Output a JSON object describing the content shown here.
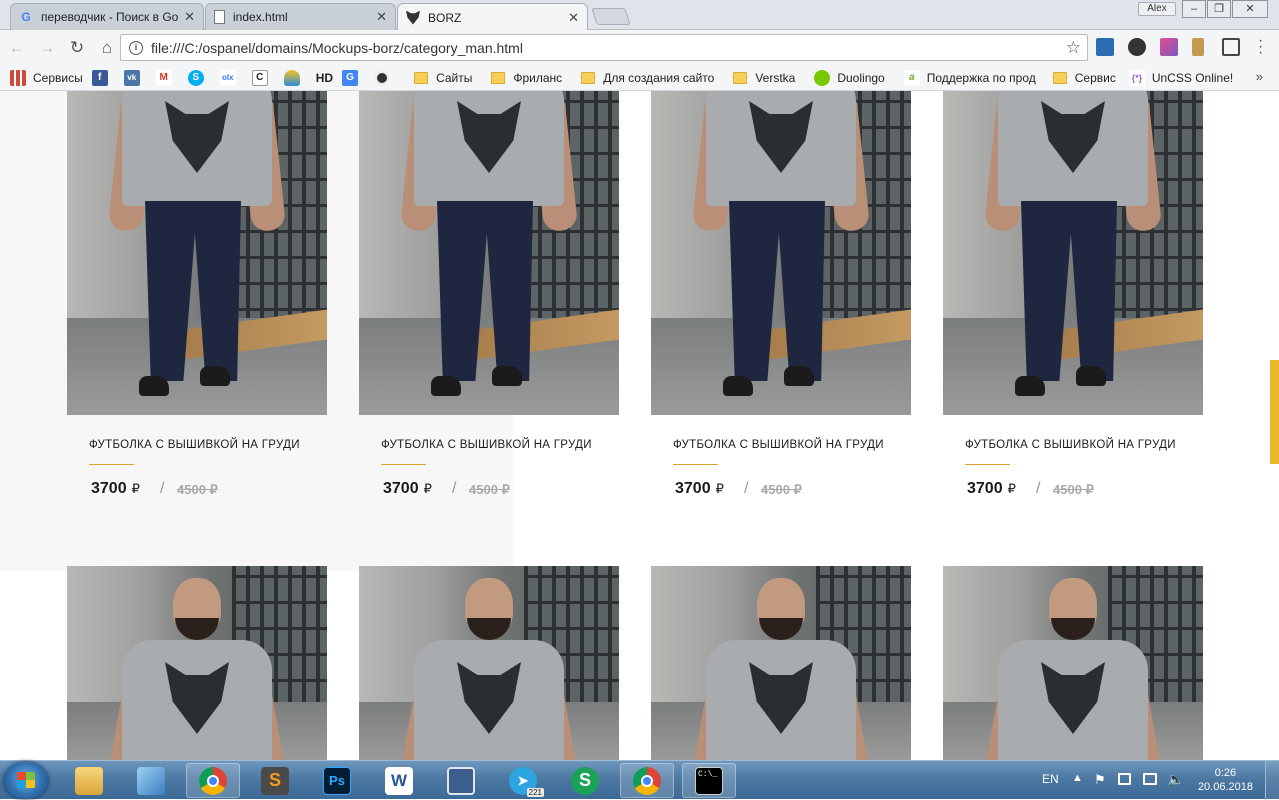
{
  "browser": {
    "tabs": [
      {
        "title": "переводчик - Поиск в Google",
        "icon": "google-icon"
      },
      {
        "title": "index.html",
        "icon": "page-icon"
      },
      {
        "title": "BORZ",
        "icon": "wolf-icon"
      }
    ],
    "user_label": "Alex",
    "url": "file:///C:/ospanel/domains/Mockups-borz/category_man.html",
    "bookmarks": [
      {
        "label": "Сервисы",
        "type": "apps"
      },
      {
        "label": "",
        "type": "facebook"
      },
      {
        "label": "",
        "type": "vk"
      },
      {
        "label": "",
        "type": "gmail"
      },
      {
        "label": "",
        "type": "skype"
      },
      {
        "label": "",
        "type": "olx"
      },
      {
        "label": "",
        "type": "cyrillic"
      },
      {
        "label": "",
        "type": "cloud"
      },
      {
        "label": "HD",
        "type": "text"
      },
      {
        "label": "",
        "type": "translate"
      },
      {
        "label": "",
        "type": "record"
      },
      {
        "label": "Сайты",
        "type": "folder"
      },
      {
        "label": "Фриланс",
        "type": "folder"
      },
      {
        "label": "Для создания сайто",
        "type": "folder"
      },
      {
        "label": "Verstka",
        "type": "folder"
      },
      {
        "label": "Duolingo",
        "type": "duolingo"
      },
      {
        "label": "Поддержка по прод",
        "type": "arrow"
      },
      {
        "label": "Сервис",
        "type": "folder"
      },
      {
        "label": "UnCSS Online!",
        "type": "uncss"
      }
    ]
  },
  "products": [
    {
      "title": "ФУТБОЛКА С ВЫШИВКОЙ НА ГРУДИ",
      "price": "3700",
      "currency": "₽",
      "old_price": "4500",
      "separator": "/"
    },
    {
      "title": "ФУТБОЛКА С ВЫШИВКОЙ НА ГРУДИ",
      "price": "3700",
      "currency": "₽",
      "old_price": "4500",
      "separator": "/"
    },
    {
      "title": "ФУТБОЛКА С ВЫШИВКОЙ НА ГРУДИ",
      "price": "3700",
      "currency": "₽",
      "old_price": "4500",
      "separator": "/"
    },
    {
      "title": "ФУТБОЛКА С ВЫШИВКОЙ НА ГРУДИ",
      "price": "3700",
      "currency": "₽",
      "old_price": "4500",
      "separator": "/"
    }
  ],
  "colors": {
    "accent": "#d6a42a",
    "scroll_thumb": "#e9b825"
  },
  "taskbar": {
    "apps": [
      {
        "name": "explorer-icon"
      },
      {
        "name": "control-panel-icon"
      },
      {
        "name": "chrome-icon"
      },
      {
        "name": "sublime-text-icon"
      },
      {
        "name": "photoshop-icon",
        "label": "Ps"
      },
      {
        "name": "word-icon",
        "label": "W"
      },
      {
        "name": "save-app-icon"
      },
      {
        "name": "telegram-icon",
        "badge": "221"
      },
      {
        "name": "skype-icon",
        "label": "S"
      },
      {
        "name": "chrome-icon"
      },
      {
        "name": "cmd-icon",
        "label": "C:\\_"
      }
    ],
    "lang": "EN",
    "time": "0:26",
    "date": "20.06.2018"
  }
}
